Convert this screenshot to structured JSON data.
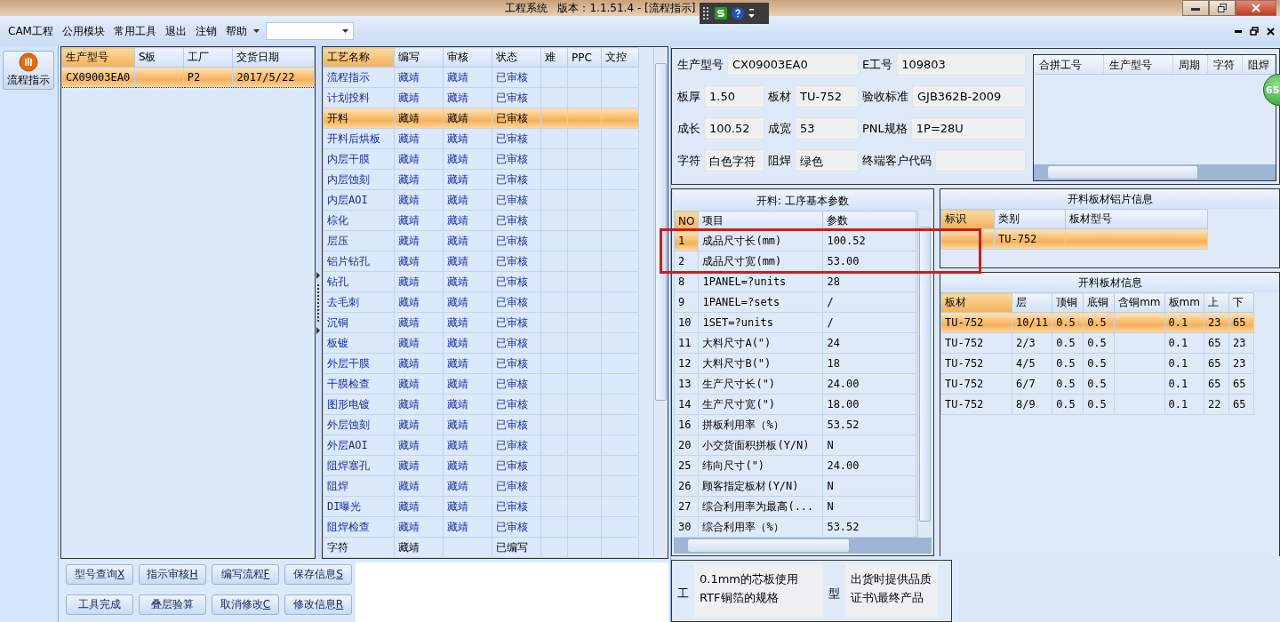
{
  "window": {
    "title": "工程系统   版本：1.1.51.4 - [流程指示]"
  },
  "menu": [
    "CAM工程",
    "公用模块",
    "常用工具",
    "退出",
    "注销",
    "帮助"
  ],
  "nav": {
    "label": "流程指示"
  },
  "orders": {
    "columns": [
      "生产型号",
      "S板",
      "工厂",
      "交货日期"
    ],
    "rows": [
      {
        "cells": [
          "CX09003EA0",
          "",
          "P2",
          "2017/5/22"
        ],
        "selected": true
      }
    ]
  },
  "process": {
    "columns": [
      "工艺名称",
      "编写",
      "审核",
      "状态",
      "难",
      "PPC",
      "文控"
    ],
    "rows": [
      {
        "cells": [
          "流程指示",
          "藏靖",
          "藏靖",
          "已审核"
        ],
        "selected": false,
        "reviewed": true
      },
      {
        "cells": [
          "计划投料",
          "藏靖",
          "藏靖",
          "已审核"
        ],
        "selected": false,
        "reviewed": true
      },
      {
        "cells": [
          "开料",
          "藏靖",
          "藏靖",
          "已审核"
        ],
        "selected": true,
        "reviewed": true
      },
      {
        "cells": [
          "开料后烘板",
          "藏靖",
          "藏靖",
          "已审核"
        ],
        "selected": false,
        "reviewed": true
      },
      {
        "cells": [
          "内层干膜",
          "藏靖",
          "藏靖",
          "已审核"
        ],
        "selected": false,
        "reviewed": true
      },
      {
        "cells": [
          "内层蚀刻",
          "藏靖",
          "藏靖",
          "已审核"
        ],
        "selected": false,
        "reviewed": true
      },
      {
        "cells": [
          "内层AOI",
          "藏靖",
          "藏靖",
          "已审核"
        ],
        "selected": false,
        "reviewed": true
      },
      {
        "cells": [
          "棕化",
          "藏靖",
          "藏靖",
          "已审核"
        ],
        "selected": false,
        "reviewed": true
      },
      {
        "cells": [
          "层压",
          "藏靖",
          "藏靖",
          "已审核"
        ],
        "selected": false,
        "reviewed": true
      },
      {
        "cells": [
          "铝片钻孔",
          "藏靖",
          "藏靖",
          "已审核"
        ],
        "selected": false,
        "reviewed": true
      },
      {
        "cells": [
          "钻孔",
          "藏靖",
          "藏靖",
          "已审核"
        ],
        "selected": false,
        "reviewed": true
      },
      {
        "cells": [
          "去毛刺",
          "藏靖",
          "藏靖",
          "已审核"
        ],
        "selected": false,
        "reviewed": true
      },
      {
        "cells": [
          "沉铜",
          "藏靖",
          "藏靖",
          "已审核"
        ],
        "selected": false,
        "reviewed": true
      },
      {
        "cells": [
          "板镀",
          "藏靖",
          "藏靖",
          "已审核"
        ],
        "selected": false,
        "reviewed": true
      },
      {
        "cells": [
          "外层干膜",
          "藏靖",
          "藏靖",
          "已审核"
        ],
        "selected": false,
        "reviewed": true
      },
      {
        "cells": [
          "干膜检查",
          "藏靖",
          "藏靖",
          "已审核"
        ],
        "selected": false,
        "reviewed": true
      },
      {
        "cells": [
          "图形电镀",
          "藏靖",
          "藏靖",
          "已审核"
        ],
        "selected": false,
        "reviewed": true
      },
      {
        "cells": [
          "外层蚀刻",
          "藏靖",
          "藏靖",
          "已审核"
        ],
        "selected": false,
        "reviewed": true
      },
      {
        "cells": [
          "外层AOI",
          "藏靖",
          "藏靖",
          "已审核"
        ],
        "selected": false,
        "reviewed": true
      },
      {
        "cells": [
          "阻焊塞孔",
          "藏靖",
          "藏靖",
          "已审核"
        ],
        "selected": false,
        "reviewed": true
      },
      {
        "cells": [
          "阻焊",
          "藏靖",
          "藏靖",
          "已审核"
        ],
        "selected": false,
        "reviewed": true
      },
      {
        "cells": [
          "DI曝光",
          "藏靖",
          "藏靖",
          "已审核"
        ],
        "selected": false,
        "reviewed": true
      },
      {
        "cells": [
          "阻焊检查",
          "藏靖",
          "藏靖",
          "已审核"
        ],
        "selected": false,
        "reviewed": true
      },
      {
        "cells": [
          "字符",
          "藏靖",
          "",
          "已编写"
        ],
        "selected": false,
        "reviewed": false
      }
    ]
  },
  "buttons": [
    {
      "label": "型号查询",
      "key": "X"
    },
    {
      "label": "指示审核",
      "key": "H"
    },
    {
      "label": "编写流程",
      "key": "F"
    },
    {
      "label": "保存信息",
      "key": "S"
    },
    {
      "label": "工具完成"
    },
    {
      "label": "叠层验算"
    },
    {
      "label": "取消修改",
      "key": "C"
    },
    {
      "label": "修改信息",
      "key": "R"
    }
  ],
  "info_form": {
    "top": [
      {
        "label": "生产型号",
        "value": "CX09003EA0"
      },
      {
        "label": "E工号",
        "value": "109803"
      }
    ],
    "rows": [
      [
        {
          "label": "板厚",
          "value": "1.50"
        },
        {
          "label": "板材",
          "value": "TU-752"
        },
        {
          "label": "验收标准",
          "value": "GJB362B-2009"
        }
      ],
      [
        {
          "label": "成长",
          "value": "100.52"
        },
        {
          "label": "成宽",
          "value": "53"
        },
        {
          "label": "PNL规格",
          "value": "1P=28U"
        }
      ],
      [
        {
          "label": "字符",
          "value": "白色字符"
        },
        {
          "label": "阻焊",
          "value": "绿色"
        },
        {
          "label": "终端客户代码"
        }
      ]
    ]
  },
  "merge_table": {
    "columns": [
      "合拼工号",
      "生产型号",
      "周期",
      "字符",
      "阻焊"
    ]
  },
  "badge": "65",
  "params": {
    "title": "开料: 工序基本参数",
    "columns": [
      "NO",
      "项目",
      "参数"
    ],
    "rows": [
      {
        "cells": [
          "1",
          "成品尺寸长(mm)",
          "100.52"
        ],
        "selected": true
      },
      {
        "cells": [
          "2",
          "成品尺寸宽(mm)",
          "53.00"
        ],
        "selected": false
      },
      {
        "cells": [
          "8",
          "1PANEL=?units",
          "28"
        ],
        "selected": false
      },
      {
        "cells": [
          "9",
          "1PANEL=?sets",
          "/"
        ],
        "selected": false
      },
      {
        "cells": [
          "10",
          "1SET=?units",
          "/"
        ],
        "selected": false
      },
      {
        "cells": [
          "11",
          "大料尺寸A(\")",
          "24"
        ],
        "selected": false
      },
      {
        "cells": [
          "12",
          "大料尺寸B(\")",
          "18"
        ],
        "selected": false
      },
      {
        "cells": [
          "13",
          "生产尺寸长(\")",
          "24.00"
        ],
        "selected": false
      },
      {
        "cells": [
          "14",
          "生产尺寸宽(\")",
          "18.00"
        ],
        "selected": false
      },
      {
        "cells": [
          "16",
          "拼板利用率（%）",
          "53.52"
        ],
        "selected": false
      },
      {
        "cells": [
          "20",
          "小交货面积拼板(Y/N)",
          "N"
        ],
        "selected": false
      },
      {
        "cells": [
          "25",
          "纬向尺寸(\")",
          "24.00"
        ],
        "selected": false
      },
      {
        "cells": [
          "26",
          "顾客指定板材(Y/N)",
          "N"
        ],
        "selected": false
      },
      {
        "cells": [
          "27",
          "综合利用率为最高(...",
          "N"
        ],
        "selected": false
      },
      {
        "cells": [
          "30",
          "综合利用率（%）",
          "53.52"
        ],
        "selected": false
      }
    ]
  },
  "aluminum": {
    "title": "开料板材铝片信息",
    "columns": [
      "标识",
      "类别",
      "板材型号"
    ],
    "rows": [
      {
        "cells": [
          "",
          "TU-752",
          ""
        ],
        "selected": true
      }
    ]
  },
  "sheets": {
    "title": "开料板材信息",
    "columns": [
      "板材",
      "层",
      "顶铜",
      "底铜",
      "含铜mm",
      "板mm",
      "上",
      "下"
    ],
    "rows": [
      {
        "cells": [
          "TU-752",
          "10/11",
          "0.5",
          "0.5",
          "",
          "0.1",
          "23",
          "65"
        ],
        "selected": true
      },
      {
        "cells": [
          "TU-752",
          "2/3",
          "0.5",
          "0.5",
          "",
          "0.1",
          "65",
          "23"
        ],
        "selected": false
      },
      {
        "cells": [
          "TU-752",
          "4/5",
          "0.5",
          "0.5",
          "",
          "0.1",
          "65",
          "23"
        ],
        "selected": false
      },
      {
        "cells": [
          "TU-752",
          "6/7",
          "0.5",
          "0.5",
          "",
          "0.1",
          "65",
          "65"
        ],
        "selected": false
      },
      {
        "cells": [
          "TU-752",
          "8/9",
          "0.5",
          "0.5",
          "",
          "0.1",
          "22",
          "65"
        ],
        "selected": false
      }
    ]
  },
  "notes": [
    {
      "label": "工",
      "text": "0.1mm的芯板使用RTF铜箔的规格"
    },
    {
      "label": "型",
      "text": "出货时提供品质证书\\最终产品"
    }
  ]
}
